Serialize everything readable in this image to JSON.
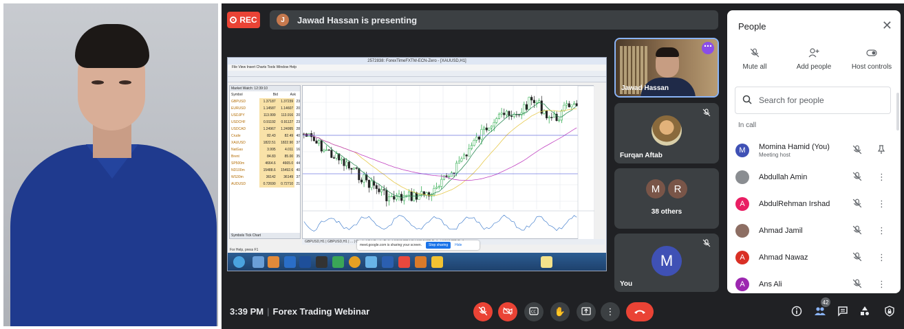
{
  "meeting": {
    "rec_label": "REC",
    "presenter_initial": "J",
    "presenting_text": "Jawad Hassan is presenting",
    "time": "3:39 PM",
    "title": "Forex Trading Webinar",
    "participant_count": "42"
  },
  "shared_screen": {
    "window_title": "2572838: ForexTimeFXTM-ECN-Zero - [XAUUSD,H1]",
    "menu": "File  View  Insert  Charts  Tools  Window  Help",
    "market_watch_title": "Market Watch: 12:39:10",
    "columns": [
      "Symbol",
      "Bid",
      "Ask",
      "!"
    ],
    "symbols": [
      {
        "s": "GBPUSD",
        "b": "1.37187",
        "a": "1.37239",
        "x": "23"
      },
      {
        "s": "EURUSD",
        "b": "1.14587",
        "a": "1.14607",
        "x": "20"
      },
      {
        "s": "USDJPY",
        "b": "113.999",
        "a": "113.916",
        "x": "20"
      },
      {
        "s": "USDCHF",
        "b": "0.91192",
        "a": "0.91127",
        "x": "23"
      },
      {
        "s": "USDCAD",
        "b": "1.24967",
        "a": "1.24995",
        "x": "28"
      },
      {
        "s": "Crude",
        "b": "82.43",
        "a": "82.49",
        "x": "40"
      },
      {
        "s": "XAUUSD",
        "b": "1822.51",
        "a": "1822.90",
        "x": "37"
      },
      {
        "s": "NatGas",
        "b": "3.995",
        "a": "4.011",
        "x": "16"
      },
      {
        "s": "Brent",
        "b": "84.83",
        "a": "85.00",
        "x": "35"
      },
      {
        "s": "SP500m",
        "b": "4664.6",
        "a": "4665.0",
        "x": "44"
      },
      {
        "s": "ND100m",
        "b": "15488.6",
        "a": "15492.6",
        "x": "40"
      },
      {
        "s": "WS30m",
        "b": "36142",
        "a": "36149",
        "x": "37"
      },
      {
        "s": "AUDUSD",
        "b": "0.72690",
        "a": "0.72710",
        "x": "21"
      }
    ],
    "mw_tabs": "Symbols  Tick Chart",
    "chart_tabs": "GBPUSD,H1 | GBPUSD,H1 | ... | Crude,H1 | Crude,Daily | XAUUSD,H1 | XAUUSD,Daily | XAUUSD,Daily",
    "status": "For Help, press F1",
    "sharing_text": "meet.google.com is sharing your screen.",
    "stop_label": "Stop sharing",
    "hide_label": "Hide"
  },
  "tiles": {
    "jawad": "Jawad Hassan",
    "furqan": "Furqan Aftab",
    "others_initials": [
      "M",
      "R"
    ],
    "others_label": "38 others",
    "you_initial": "M",
    "you_label": "You"
  },
  "people_panel": {
    "title": "People",
    "actions": [
      "Mute all",
      "Add people",
      "Host controls"
    ],
    "search_placeholder": "Search for people",
    "section": "In call",
    "participants": [
      {
        "name": "Momina Hamid (You)",
        "sub": "Meeting host",
        "initial": "M",
        "color": "#3f51b5"
      },
      {
        "name": "Abdullah Amin",
        "sub": "",
        "initial": "",
        "color": "#8a8d91"
      },
      {
        "name": "AbdulRehman Irshad",
        "sub": "",
        "initial": "A",
        "color": "#e91e63"
      },
      {
        "name": "Ahmad Jamil",
        "sub": "",
        "initial": "",
        "color": "#8d6e63"
      },
      {
        "name": "Ahmad Nawaz",
        "sub": "",
        "initial": "A",
        "color": "#d93025"
      },
      {
        "name": "Ans Ali",
        "sub": "",
        "initial": "A",
        "color": "#9c27b0"
      }
    ]
  },
  "colors": {
    "accent_red": "#ea4335",
    "accent_blue": "#1a73e8",
    "meet_bg": "#202124"
  }
}
